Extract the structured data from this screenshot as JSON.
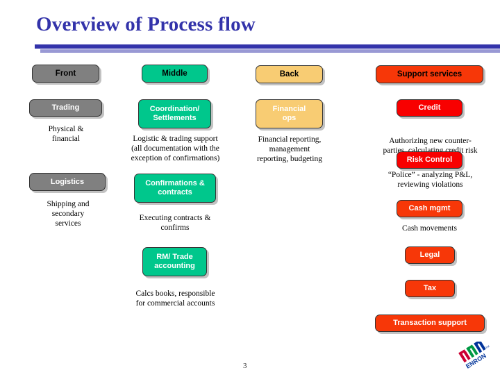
{
  "slide": {
    "title": "Overview of Process flow",
    "page_number": "3",
    "accent_dark": "#3333aa",
    "accent_light": "#9999d4",
    "title_color": "#3333aa"
  },
  "headers": [
    {
      "label": "Front",
      "color": "#808080"
    },
    {
      "label": "Middle",
      "color": "#00c78c"
    },
    {
      "label": "Back",
      "color": "#f8cc73"
    },
    {
      "label": "Support services",
      "color": "#f73708"
    }
  ],
  "columns": {
    "front": {
      "boxes": [
        {
          "label": "Trading",
          "color": "#808080",
          "caption": "Physical &\nfinancial"
        },
        {
          "label": "Logistics",
          "color": "#808080",
          "caption": "Shipping and\nsecondary\nservices"
        }
      ],
      "trading_label": "Trading",
      "trading_caption_line1": "Physical &",
      "trading_caption_line2": "financial",
      "logistics_label": "Logistics",
      "logistics_caption_line1": "Shipping and",
      "logistics_caption_line2": "secondary",
      "logistics_caption_line3": "services"
    },
    "middle": {
      "coordination_label_line1": "Coordination/",
      "coordination_label_line2": "Settlements",
      "coordination_caption_line1": "Logistic & trading support",
      "coordination_caption_line2": "(all documentation with the",
      "coordination_caption_line3": "exception of confirmations)",
      "confirmations_label_line1": "Confirmations &",
      "confirmations_label_line2": "contracts",
      "confirmations_caption_line1": "Executing contracts &",
      "confirmations_caption_line2": "confirms",
      "rm_label_line1": "RM/ Trade",
      "rm_label_line2": "accounting",
      "rm_caption_line1": "Calcs books, responsible",
      "rm_caption_line2": "for commercial accounts"
    },
    "back": {
      "finops_label_line1": "Financial",
      "finops_label_line2": "ops",
      "finops_caption_line1": "Financial reporting,",
      "finops_caption_line2": "management",
      "finops_caption_line3": "reporting, budgeting"
    },
    "support": {
      "credit_label": "Credit",
      "credit_caption_line1": "Authorizing new counter-",
      "credit_caption_line2": "parties, calculating credit risk",
      "risk_label": "Risk Control",
      "risk_caption_line1": "“Police” - analyzing P&L,",
      "risk_caption_line2": "reviewing violations",
      "cash_label": "Cash mgmt",
      "cash_caption": "Cash movements",
      "legal_label": "Legal",
      "tax_label": "Tax",
      "transaction_label": "Transaction support"
    }
  },
  "logo": {
    "name": "enron-logo",
    "wordmark": "ENRON",
    "bar_colors": [
      "#cc0033",
      "#009944",
      "#003399"
    ]
  }
}
